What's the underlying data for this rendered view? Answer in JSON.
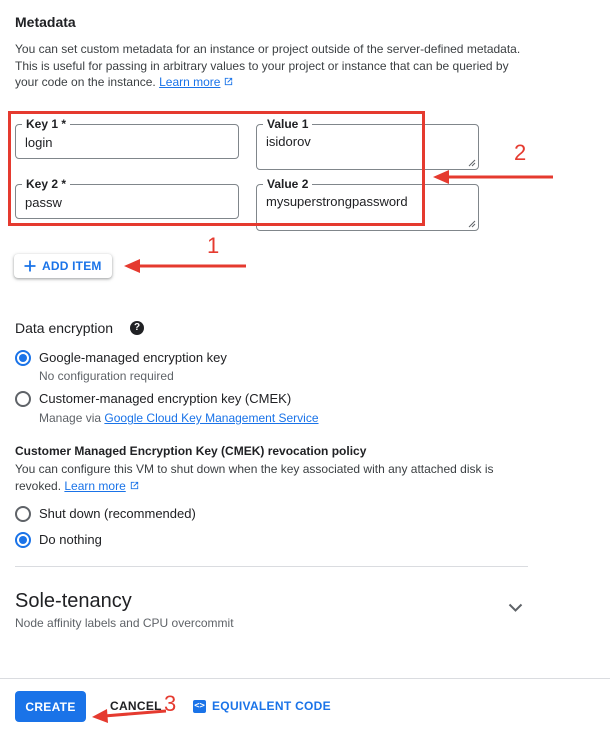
{
  "metadata": {
    "title": "Metadata",
    "description": "You can set custom metadata for an instance or project outside of the server-defined metadata. This is useful for passing in arbitrary values to your project or instance that can be queried by your code on the instance.",
    "desc_line1": "You can set custom metadata for an instance or project outside of the server-defined metadata.",
    "desc_line2": "This is useful for passing in arbitrary values to your project or instance that can be queried by",
    "desc_line3": "your code on the instance.",
    "learn_more": "Learn more",
    "items": [
      {
        "key_label": "Key 1 *",
        "key_value": "login",
        "value_label": "Value 1",
        "value_value": "isidorov"
      },
      {
        "key_label": "Key 2 *",
        "key_value": "passw",
        "value_label": "Value 2",
        "value_value": "mysuperstrongpassword"
      }
    ],
    "add_item": "ADD ITEM"
  },
  "encryption": {
    "title": "Data encryption",
    "help_glyph": "?",
    "options": [
      {
        "label": "Google-managed encryption key",
        "sub": "No configuration required",
        "selected": true
      },
      {
        "label": "Customer-managed encryption key (CMEK)",
        "sub_prefix": "Manage via",
        "sub_link": "Google Cloud Key Management Service",
        "selected": false
      }
    ]
  },
  "revocation": {
    "title": "Customer Managed Encryption Key (CMEK) revocation policy",
    "desc_line1": "You can configure this VM to shut down when the key associated with any attached disk is",
    "desc_line2": "revoked.",
    "learn_more": "Learn more",
    "options": [
      {
        "label": "Shut down (recommended)",
        "selected": false
      },
      {
        "label": "Do nothing",
        "selected": true
      }
    ]
  },
  "sole_tenancy": {
    "title": "Sole-tenancy",
    "subtitle": "Node affinity labels and CPU overcommit"
  },
  "footer": {
    "create": "CREATE",
    "cancel": "CANCEL",
    "equivalent_code": "EQUIVALENT CODE",
    "eq_icon_glyph": "<>"
  },
  "annotations": {
    "one": "1",
    "two": "2",
    "three": "3",
    "color": "#e53a2f"
  },
  "colors": {
    "accent": "#1a73e8",
    "annotation": "#e53a2f"
  }
}
